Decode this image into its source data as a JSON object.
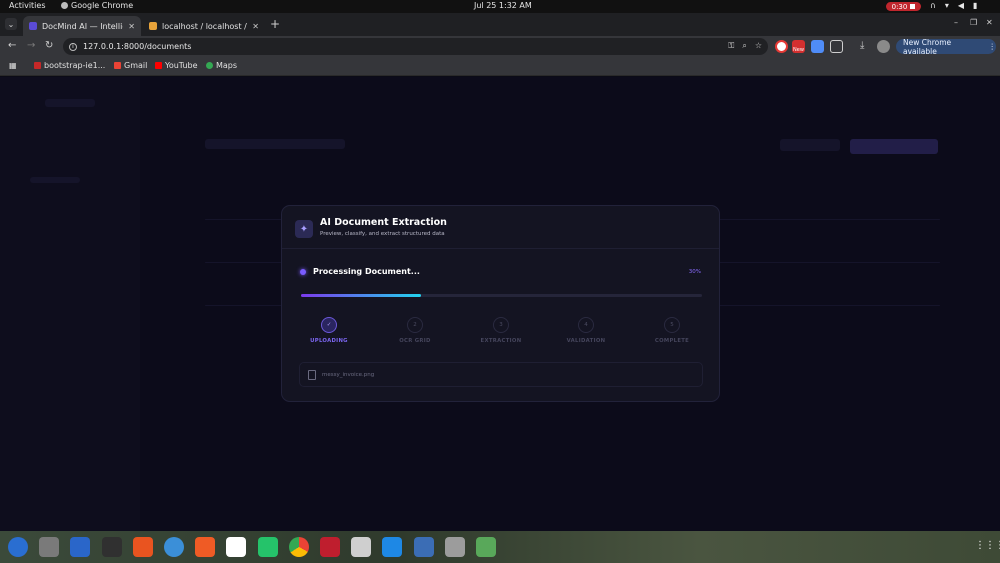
{
  "system_bar": {
    "activities": "Activities",
    "app_name": "Google Chrome",
    "clock": "Jul 25  1:32 AM",
    "recording": "0:30"
  },
  "browser": {
    "tabs": [
      {
        "title": "DocMind AI — Intelligen",
        "active": true
      },
      {
        "title": "localhost / localhost / m",
        "active": false
      }
    ],
    "url": "127.0.0.1:8000/documents",
    "new_chrome": "New Chrome available",
    "ext_badge": "New",
    "bookmarks": [
      {
        "label": "bootstrap-ie1...",
        "color": "#c62828"
      },
      {
        "label": "Gmail",
        "color": "#ea4335"
      },
      {
        "label": "YouTube",
        "color": "#ff0000"
      },
      {
        "label": "Maps",
        "color": "#34a853"
      }
    ]
  },
  "modal": {
    "title": "AI Document Extraction",
    "subtitle": "Preview, classify, and extract structured data",
    "status": "Processing Document...",
    "percent_label": "30%",
    "progress": 0.3,
    "steps": [
      {
        "num": "✓",
        "label": "UPLOADING",
        "active": true
      },
      {
        "num": "2",
        "label": "OCR GRID",
        "active": false
      },
      {
        "num": "3",
        "label": "EXTRACTION",
        "active": false
      },
      {
        "num": "4",
        "label": "VALIDATION",
        "active": false
      },
      {
        "num": "5",
        "label": "COMPLETE",
        "active": false
      }
    ],
    "file_name": "messy_invoice.png"
  },
  "colors": {
    "accent": "#7a5cff",
    "progress_start": "#7c3aed",
    "progress_end": "#22d3ee"
  },
  "dock": [
    {
      "name": "thunderbird",
      "color": "#2a6ed1"
    },
    {
      "name": "files",
      "color": "#7a7a7a"
    },
    {
      "name": "writer",
      "color": "#2a66c9"
    },
    {
      "name": "terminal",
      "color": "#303030"
    },
    {
      "name": "app-center",
      "color": "#e95420"
    },
    {
      "name": "help",
      "color": "#3b8fd8"
    },
    {
      "name": "postman",
      "color": "#ef5b25"
    },
    {
      "name": "text-editor",
      "color": "#ffffff"
    },
    {
      "name": "sync",
      "color": "#25c36a"
    },
    {
      "name": "chrome",
      "color": "#e3e3e3"
    },
    {
      "name": "filezilla",
      "color": "#bf1e2e"
    },
    {
      "name": "image-viewer",
      "color": "#cfcfcf"
    },
    {
      "name": "vscode",
      "color": "#1e88e5"
    },
    {
      "name": "android-studio",
      "color": "#3b6db5"
    },
    {
      "name": "settings",
      "color": "#9c9c9c"
    },
    {
      "name": "trash",
      "color": "#59a85a"
    }
  ]
}
